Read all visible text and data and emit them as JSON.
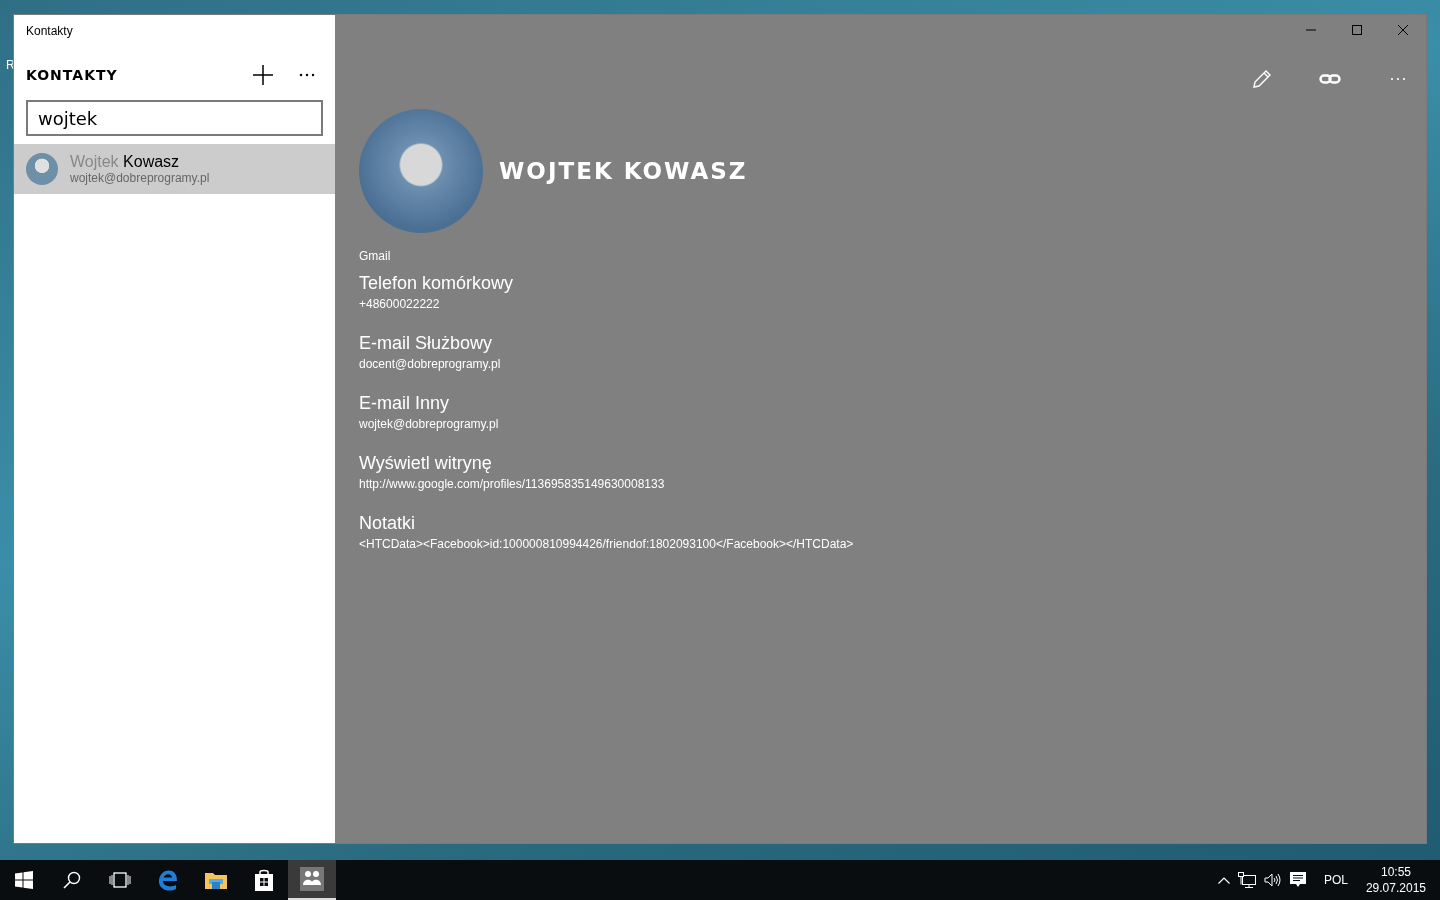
{
  "desktop": {
    "icon_label_fragment": "R"
  },
  "window": {
    "title": "Kontakty"
  },
  "sidebar": {
    "heading": "KONTAKTY",
    "search": {
      "value": "wojtek"
    },
    "results": [
      {
        "name_match": "Wojtek",
        "name_rest": "Kowasz",
        "email": "wojtek@dobreprogramy.pl",
        "selected": true
      }
    ]
  },
  "contact": {
    "name": "WOJTEK KOWASZ",
    "account": "Gmail",
    "fields": [
      {
        "label": "Telefon komórkowy",
        "value": "+48600022222"
      },
      {
        "label": "E-mail Służbowy",
        "value": "docent@dobreprogramy.pl"
      },
      {
        "label": "E-mail Inny",
        "value": "wojtek@dobreprogramy.pl"
      },
      {
        "label": "Wyświetl witrynę",
        "value": "http://www.google.com/profiles/113695835149630008133"
      },
      {
        "label": "Notatki",
        "value": "<HTCData><Facebook>id:100000810994426/friendof:1802093100</Facebook></HTCData>"
      }
    ]
  },
  "taskbar": {
    "apps": [
      {
        "kind": "start",
        "active": false
      },
      {
        "kind": "search",
        "active": false
      },
      {
        "kind": "taskview",
        "active": false
      },
      {
        "kind": "edge",
        "active": false
      },
      {
        "kind": "explorer",
        "active": false
      },
      {
        "kind": "store",
        "active": false
      },
      {
        "kind": "people",
        "active": true
      }
    ],
    "language": "POL",
    "time": "10:55",
    "date": "29.07.2015"
  }
}
